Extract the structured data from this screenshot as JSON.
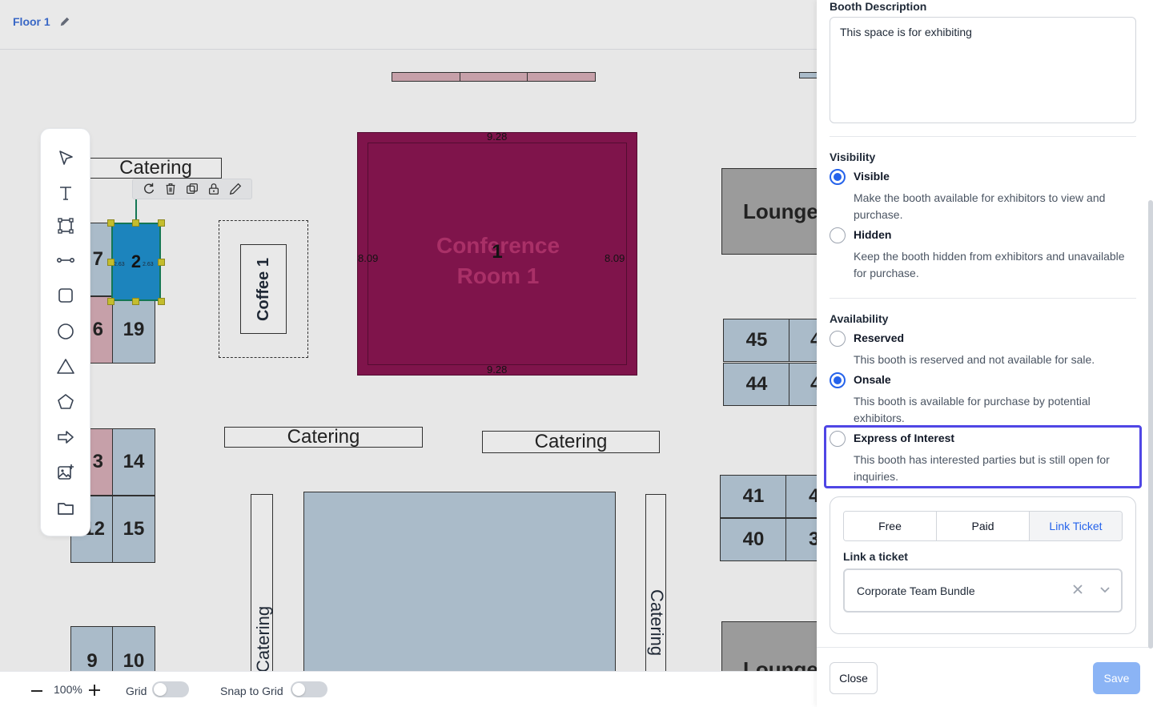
{
  "header": {
    "floor_title": "Floor 1"
  },
  "canvas": {
    "booths": [
      "7",
      "6",
      "19",
      "3",
      "14",
      "12",
      "15",
      "9",
      "10",
      "45",
      "44",
      "41",
      "40",
      "4",
      "4",
      "4",
      "3"
    ],
    "selected_booth": "2",
    "selected_dims": [
      "2.63",
      "2.63"
    ],
    "caterings": [
      "Catering",
      "Catering",
      "Catering",
      "Catering",
      "Catering"
    ],
    "lounges": [
      "Lounge",
      "Lounge"
    ],
    "coffee": "Coffee 1",
    "conference": {
      "name": "Conference Room 1",
      "number": "1",
      "top_dim": "9.28",
      "bottom_dim": "9.28",
      "left_dim": "8.09",
      "right_dim": "8.09"
    }
  },
  "bottombar": {
    "zoom": "100%",
    "grid_label": "Grid",
    "snap_label": "Snap to Grid"
  },
  "panel": {
    "description_title": "Booth Description",
    "description_value": "This space is for exhibiting",
    "visibility": {
      "title": "Visibility",
      "options": [
        {
          "label": "Visible",
          "desc": "Make the booth available for exhibitors to view and purchase.",
          "selected": true
        },
        {
          "label": "Hidden",
          "desc": "Keep the booth hidden from exhibitors and unavailable for purchase.",
          "selected": false
        }
      ]
    },
    "availability": {
      "title": "Availability",
      "options": [
        {
          "label": "Reserved",
          "desc": "This booth is reserved and not available for sale.",
          "selected": false
        },
        {
          "label": "Onsale",
          "desc": "This booth is available for purchase by potential exhibitors.",
          "selected": true
        },
        {
          "label": "Express of Interest",
          "desc": "This booth has interested parties but is still open for inquiries.",
          "selected": false
        }
      ]
    },
    "ticket": {
      "tabs": [
        "Free",
        "Paid",
        "Link Ticket"
      ],
      "active_tab": "Link Ticket",
      "link_label": "Link a ticket",
      "selected_ticket": "Corporate Team Bundle"
    },
    "footer": {
      "close_label": "Close",
      "save_label": "Save"
    }
  },
  "colors": {
    "accent": "#2563eb",
    "highlight": "#4f46e5",
    "conference": "#8a1250",
    "selected_booth": "#1b8fcf"
  }
}
